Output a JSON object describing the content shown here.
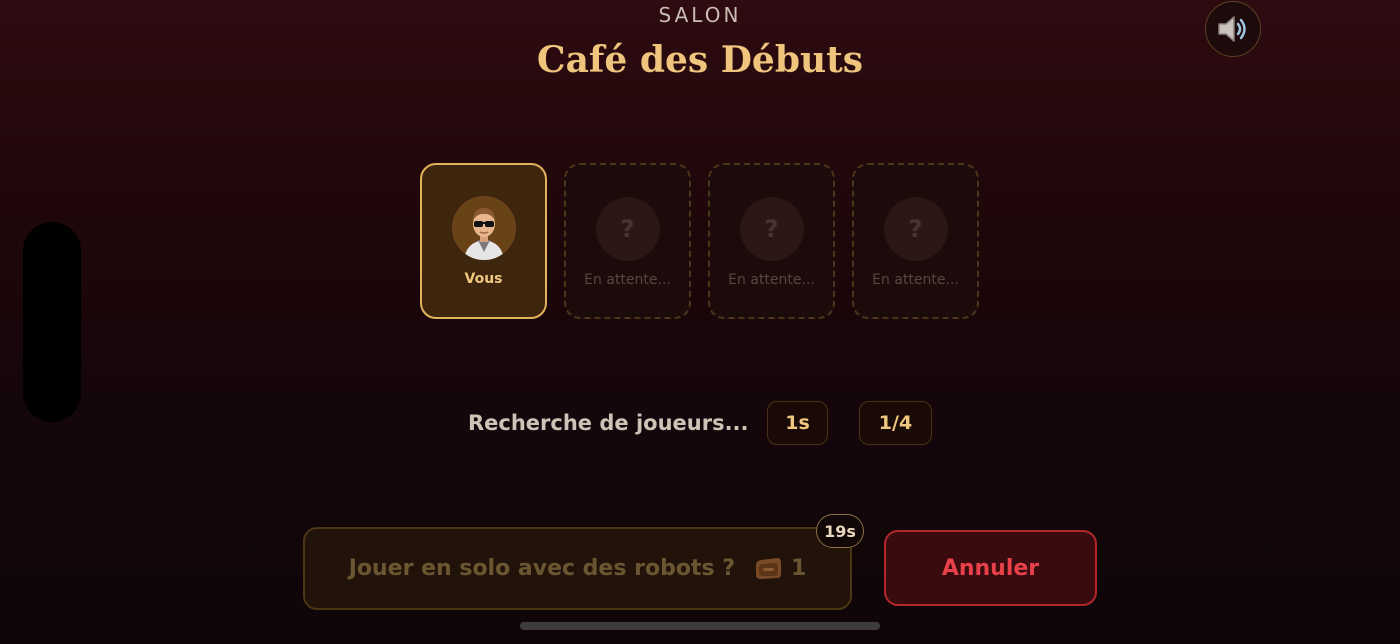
{
  "header": {
    "eyebrow": "SALON",
    "title": "Café des Débuts"
  },
  "sound_button": {
    "icon": "speaker-icon"
  },
  "players": [
    {
      "label": "Vous",
      "state": "joined",
      "icon": "player-avatar"
    },
    {
      "label": "En attente...",
      "state": "waiting",
      "placeholder": "?"
    },
    {
      "label": "En attente...",
      "state": "waiting",
      "placeholder": "?"
    },
    {
      "label": "En attente...",
      "state": "waiting",
      "placeholder": "?"
    }
  ],
  "search": {
    "status": "Recherche de joueurs...",
    "elapsed": "1s",
    "count": "1/4"
  },
  "solo": {
    "label": "Jouer en solo avec des robots ?",
    "cost": "1",
    "cost_icon": "ticket-icon",
    "countdown": "19s"
  },
  "cancel": {
    "label": "Annuler"
  },
  "colors": {
    "gold": "#efc57d",
    "danger": "#e8414a",
    "background": "#1e0709"
  }
}
